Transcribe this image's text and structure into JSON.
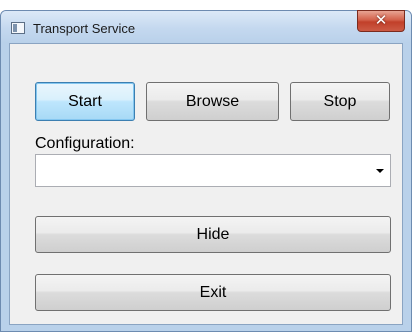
{
  "window": {
    "title": "Transport Service",
    "close_glyph": "✕"
  },
  "toolbar": {
    "start_label": "Start",
    "browse_label": "Browse",
    "stop_label": "Stop"
  },
  "configuration": {
    "label": "Configuration:",
    "selected_value": ""
  },
  "actions": {
    "hide_label": "Hide",
    "exit_label": "Exit"
  },
  "icons": {
    "app": "app-window-icon",
    "close": "close-icon",
    "dropdown": "chevron-down-icon"
  },
  "colors": {
    "focus_border": "#3c7fb1",
    "close_red": "#c1402a",
    "frame": "#b9d1ea"
  }
}
